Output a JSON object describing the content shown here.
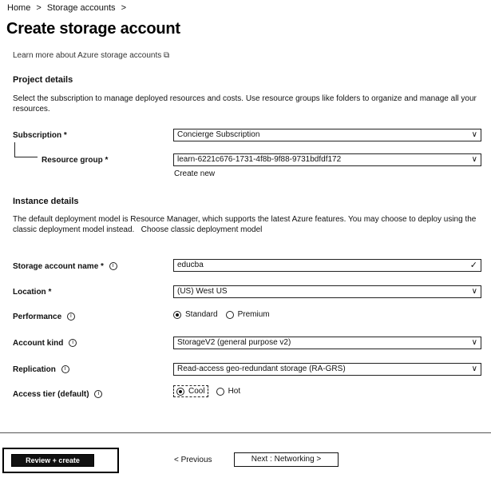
{
  "breadcrumb": {
    "home": "Home",
    "sep1": ">",
    "storage_accounts": "Storage accounts",
    "sep2": ">"
  },
  "page_title": "Create storage account",
  "learn_more": "Learn more about Azure storage accounts",
  "project": {
    "title": "Project details",
    "description": "Select the subscription to manage deployed resources and costs. Use resource groups like folders to organize and manage all your resources.",
    "subscription_label": "Subscription *",
    "subscription_value": "Concierge Subscription",
    "resource_group_label": "Resource group *",
    "resource_group_value": "learn-6221c676-1731-4f8b-9f88-9731bdfdf172",
    "create_new": "Create new"
  },
  "instance": {
    "title": "Instance details",
    "description": "The default deployment model is Resource Manager, which supports the latest Azure features. You may choose to deploy using the classic deployment model instead.",
    "classic_link": "Choose classic deployment model",
    "storage_name_label": "Storage account name *",
    "storage_name_value": "educba",
    "location_label": "Location *",
    "location_value": "(US) West US",
    "performance_label": "Performance",
    "performance_options": [
      "Standard",
      "Premium"
    ],
    "performance_selected": "Standard",
    "account_kind_label": "Account kind",
    "account_kind_value": "StorageV2 (general purpose v2)",
    "replication_label": "Replication",
    "replication_value": "Read-access geo-redundant storage (RA-GRS)",
    "access_tier_label": "Access tier (default)",
    "access_tier_options": [
      "Cool",
      "Hot"
    ],
    "access_tier_selected": "Cool"
  },
  "footer": {
    "review_create": "Review + create",
    "previous": "< Previous",
    "next": "Next : Networking >"
  },
  "icons": {
    "chevron": "chevron-down-icon",
    "check": "checkmark-icon",
    "info": "info-icon"
  }
}
